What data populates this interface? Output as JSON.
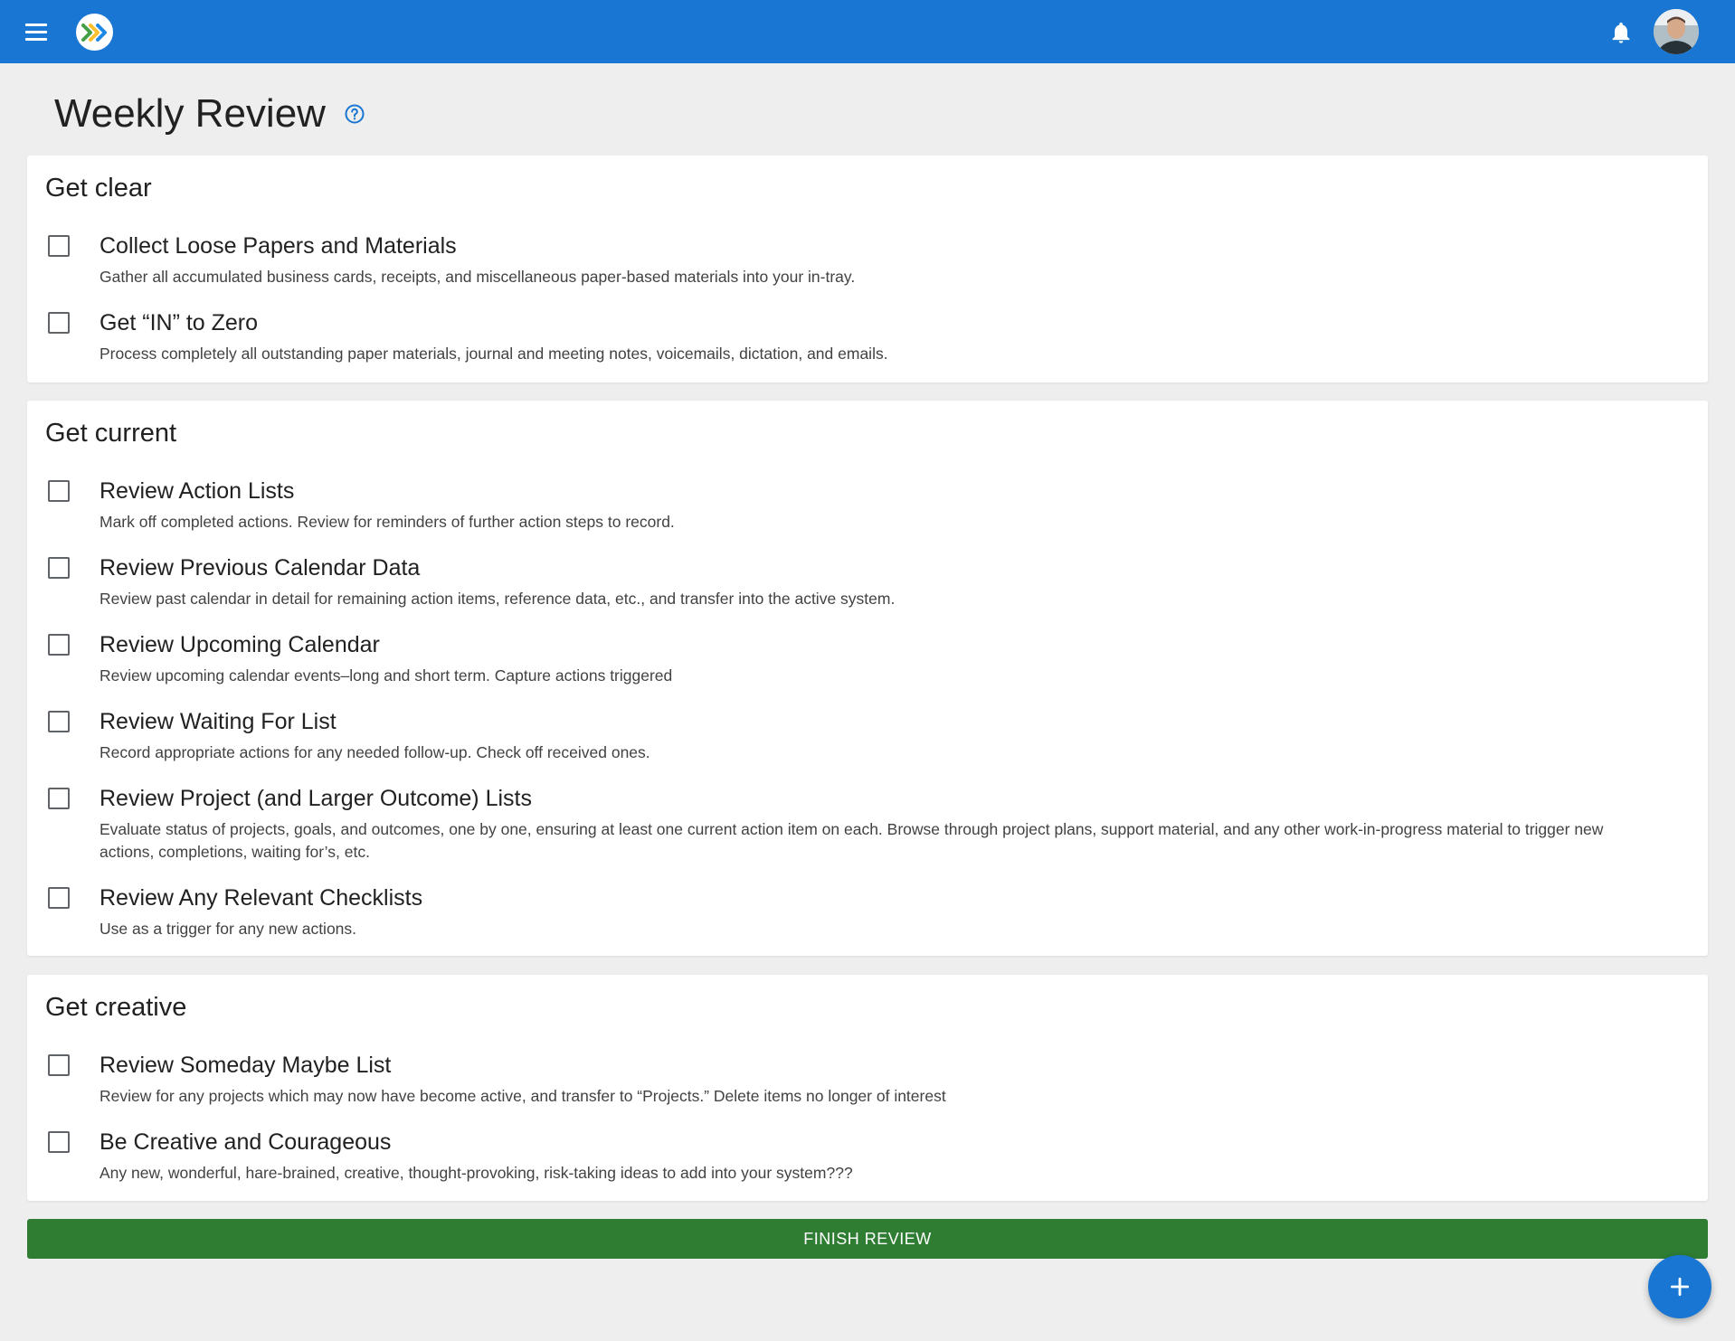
{
  "page": {
    "title": "Weekly Review"
  },
  "icons": {
    "menu": "menu-icon",
    "logo": "app-logo",
    "bell": "bell-icon",
    "help": "help-icon",
    "add": "plus-icon"
  },
  "colors": {
    "appbar": "#1976d2",
    "finish_button": "#2e7d32",
    "fab": "#1976d2",
    "background": "#eeeeee"
  },
  "sections": [
    {
      "title": "Get clear",
      "items": [
        {
          "title": "Collect Loose Papers and Materials",
          "description": "Gather all accumulated business cards, receipts, and miscellaneous paper-based materials into your in-tray.",
          "checked": false
        },
        {
          "title": "Get “IN” to Zero",
          "description": "Process completely all outstanding paper materials, journal and meeting notes, voicemails, dictation, and emails.",
          "checked": false
        }
      ]
    },
    {
      "title": "Get current",
      "items": [
        {
          "title": "Review Action Lists",
          "description": "Mark off completed actions. Review for reminders of further action steps to record.",
          "checked": false
        },
        {
          "title": "Review Previous Calendar Data",
          "description": "Review past calendar in detail for remaining action items, reference data, etc., and transfer into the active system.",
          "checked": false
        },
        {
          "title": "Review Upcoming Calendar",
          "description": "Review upcoming calendar events–long and short term. Capture actions triggered",
          "checked": false
        },
        {
          "title": "Review Waiting For List",
          "description": "Record appropriate actions for any needed follow-up. Check off received ones.",
          "checked": false
        },
        {
          "title": "Review Project (and Larger Outcome) Lists",
          "description": "Evaluate status of projects, goals, and outcomes, one by one, ensuring at least one current action item on each. Browse through project plans, support material, and any other work-in-progress material to trigger new actions, completions, waiting for’s, etc.",
          "checked": false
        },
        {
          "title": "Review Any Relevant Checklists",
          "description": "Use as a trigger for any new actions.",
          "checked": false
        }
      ]
    },
    {
      "title": "Get creative",
      "items": [
        {
          "title": "Review Someday Maybe List",
          "description": "Review for any projects which may now have become active, and transfer to “Projects.” Delete items no longer of interest",
          "checked": false
        },
        {
          "title": "Be Creative and Courageous",
          "description": "Any new, wonderful, hare-brained, creative, thought-provoking, risk-taking ideas to add into your system???",
          "checked": false
        }
      ]
    }
  ],
  "actions": {
    "finish_label": "FINISH REVIEW"
  }
}
